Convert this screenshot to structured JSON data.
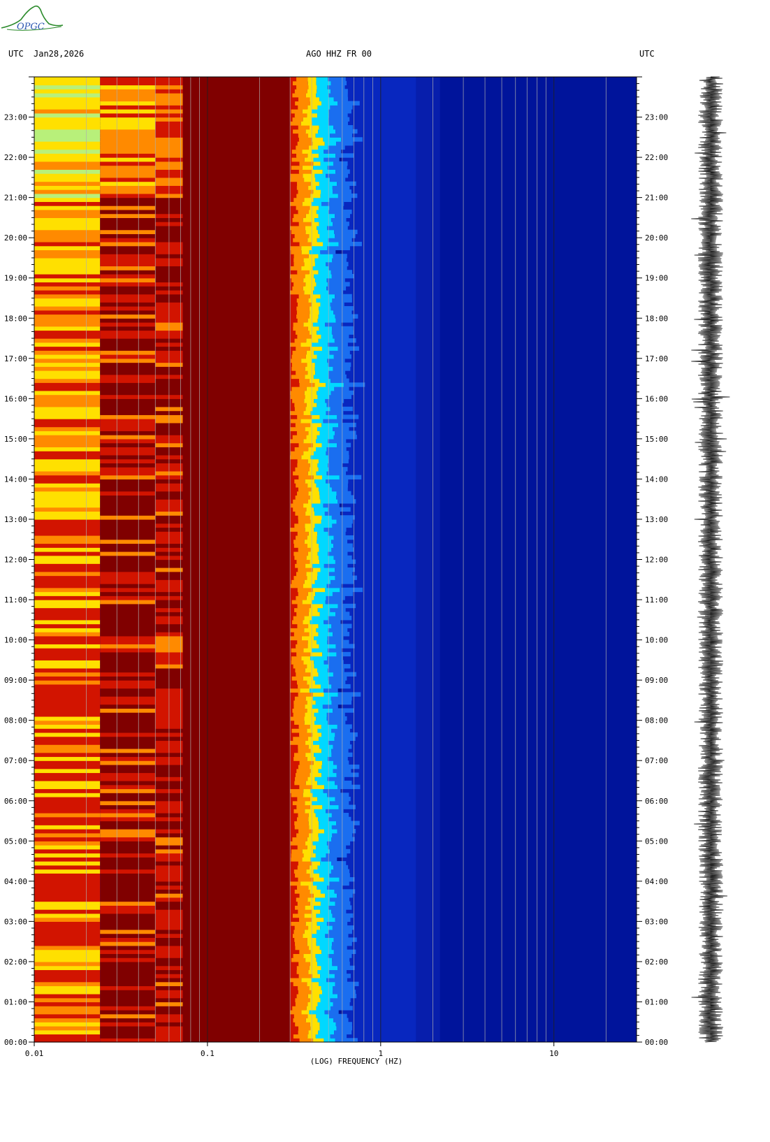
{
  "header": {
    "left_tz": "UTC",
    "date": "Jan28,2026",
    "station": "AGO HHZ FR 00",
    "right_tz": "UTC"
  },
  "logo": {
    "text": "OPGC"
  },
  "colors": {
    "background_low": "#00149b",
    "background_mid": "#0a2cc8",
    "dark_red": "#800000",
    "red": "#d21400",
    "orange": "#ff8a00",
    "yellow": "#ffe000",
    "cyan": "#00d8ff",
    "light_green": "#b8f07a"
  },
  "chart_data": {
    "type": "heatmap",
    "title": "AGO HHZ FR 00",
    "xlabel": "(LOG) FREQUENCY (HZ)",
    "ylabel": "",
    "x_scale": "log",
    "xlim": [
      0.01,
      30
    ],
    "x_ticks": [
      {
        "value": 0.01,
        "label": "0.01"
      },
      {
        "value": 0.1,
        "label": "0.1"
      },
      {
        "value": 1,
        "label": "1"
      },
      {
        "value": 10,
        "label": "10"
      }
    ],
    "ylim_hours": [
      0,
      24
    ],
    "y_ticks": [
      "00:00",
      "01:00",
      "02:00",
      "03:00",
      "04:00",
      "05:00",
      "06:00",
      "07:00",
      "08:00",
      "09:00",
      "10:00",
      "11:00",
      "12:00",
      "13:00",
      "14:00",
      "15:00",
      "16:00",
      "17:00",
      "18:00",
      "19:00",
      "20:00",
      "21:00",
      "22:00",
      "23:00"
    ],
    "grid": true,
    "spectral_bands": [
      {
        "from_hz": 0.01,
        "to_hz": 0.024,
        "description": "yellow/orange/red alternating, light green above 21:00"
      },
      {
        "from_hz": 0.024,
        "to_hz": 0.05,
        "description": "dark red with orange/yellow streaks"
      },
      {
        "from_hz": 0.05,
        "to_hz": 0.072,
        "description": "red with orange streaks"
      },
      {
        "from_hz": 0.072,
        "to_hz": 0.3,
        "description": "dark red"
      },
      {
        "from_hz": 0.3,
        "to_hz": 0.7,
        "description": "transition red-yellow-cyan-blue"
      },
      {
        "from_hz": 0.7,
        "to_hz": 30,
        "description": "deep blue"
      }
    ],
    "seismogram": {
      "present": true,
      "position": "right"
    }
  }
}
